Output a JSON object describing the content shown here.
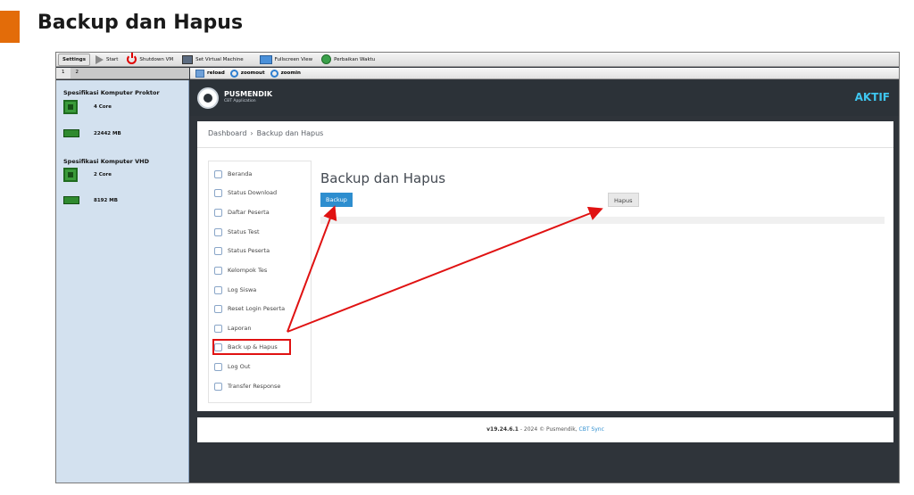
{
  "slide": {
    "title": "Backup dan Hapus",
    "accent_color": "#e36c09"
  },
  "vm_toolbar": {
    "settings_label": "Settings",
    "start_label": "Start",
    "shutdown_label": "Shutdown VM",
    "set_vm_label": "Set Virtual Machine",
    "fullscreen_label": "Fullscreen View",
    "fix_time_label": "Perbaikan Waktu"
  },
  "side_tabs": [
    "1",
    "2"
  ],
  "specs": {
    "proktor_title": "Spesifikasi Komputer Proktor",
    "proktor_cpu": "4 Core",
    "proktor_ram": "22442 MB",
    "vhd_title": "Spesifikasi Komputer VHD",
    "vhd_cpu": "2 Core",
    "vhd_ram": "8192 MB"
  },
  "browser_bar": {
    "reload_label": "reload",
    "zoomout_label": "zoomout",
    "zoomin_label": "zoomin"
  },
  "app": {
    "logo_name": "PUSMENDIK",
    "logo_sub": "CBT Application",
    "status": "AKTIF",
    "status_color": "#3ec6f0",
    "breadcrumb": {
      "home": "Dashboard",
      "separator": "›",
      "current": "Backup dan Hapus"
    },
    "nav": [
      {
        "label": "Beranda"
      },
      {
        "label": "Status Download"
      },
      {
        "label": "Daftar Peserta"
      },
      {
        "label": "Status Test"
      },
      {
        "label": "Status Peserta"
      },
      {
        "label": "Kelompok Tes"
      },
      {
        "label": "Log Siswa"
      },
      {
        "label": "Reset Login Peserta"
      },
      {
        "label": "Laporan"
      },
      {
        "label": "Back up & Hapus"
      },
      {
        "label": "Log Out"
      },
      {
        "label": "Transfer Response"
      }
    ],
    "page_title": "Backup dan Hapus",
    "backup_label": "Backup",
    "hapus_label": "Hapus",
    "footer": {
      "version": "v19.24.6.1",
      "rest": " - 2024 © Pusmendik, ",
      "link": "CBT Sync"
    }
  },
  "annotation_color": "#e01212"
}
